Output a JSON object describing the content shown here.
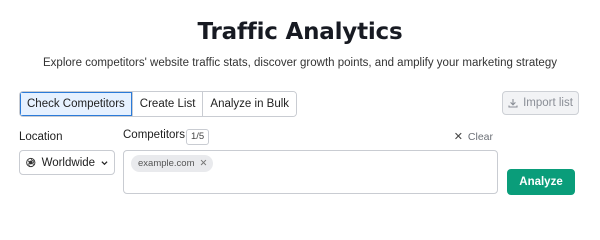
{
  "header": {
    "title": "Traffic Analytics",
    "subtitle": "Explore competitors' website traffic stats, discover growth points, and amplify your marketing strategy"
  },
  "tabs": [
    {
      "label": "Check Competitors",
      "active": true
    },
    {
      "label": "Create List",
      "active": false
    },
    {
      "label": "Analyze in Bulk",
      "active": false
    }
  ],
  "import_button": {
    "label": "Import list",
    "icon": "download-icon",
    "disabled": true
  },
  "location": {
    "label": "Location",
    "selected": "Worldwide",
    "icon": "globe-icon"
  },
  "competitors": {
    "label": "Competitors",
    "count": "1/5",
    "clear_label": "Clear",
    "chips": [
      {
        "value": "example.com"
      }
    ]
  },
  "analyze_button": {
    "label": "Analyze",
    "color": "#0a9d7a"
  },
  "colors": {
    "accent": "#2b7bd9",
    "active_tab_bg": "#e6f1ff",
    "primary_button": "#0a9d7a"
  }
}
